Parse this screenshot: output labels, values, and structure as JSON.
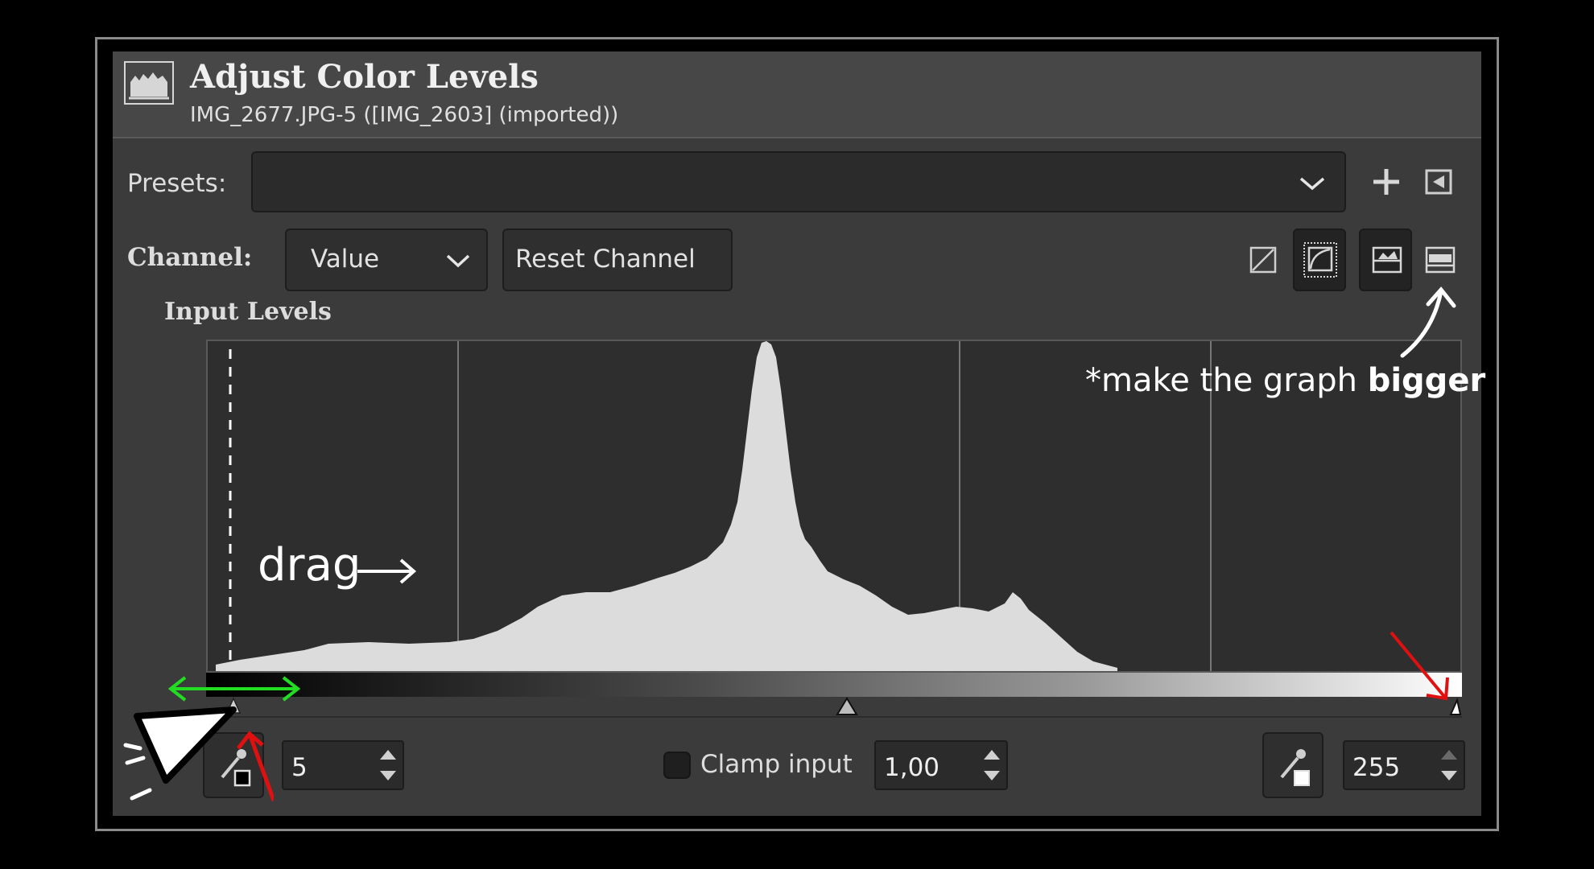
{
  "dialog": {
    "title": "Adjust Color Levels",
    "subtitle": "IMG_2677.JPG-5 ([IMG_2603] (imported))",
    "icon": "histogram-icon"
  },
  "presets": {
    "label": "Presets:",
    "value": "",
    "add_icon": "plus-icon",
    "menu_icon": "triangle-left-icon"
  },
  "channel": {
    "label": "Channel:",
    "selected": "Value",
    "reset_label": "Reset Channel",
    "icons": [
      "linear-histogram-icon",
      "log-histogram-icon",
      "graph-layout-icon",
      "graph-expand-icon"
    ]
  },
  "input_levels": {
    "section_label": "Input Levels",
    "low_value": "5",
    "high_value": "255",
    "gamma_value": "1,00",
    "clamp_label": "Clamp input",
    "clamp_checked": false
  },
  "annotations": {
    "drag_text": "drag",
    "bigger_prefix": "*make the graph ",
    "bigger_bold": "bigger"
  },
  "colors": {
    "panel_bg": "#3b3b3b",
    "histogram_fill": "#dcdcdc",
    "arrow_green": "#22dd22",
    "arrow_red": "#e01010"
  }
}
